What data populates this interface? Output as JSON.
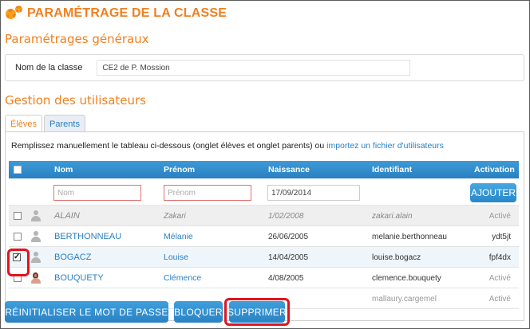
{
  "header": {
    "title": "PARAMÉTRAGE DE LA CLASSE",
    "icon": "gears-icon"
  },
  "general": {
    "title": "Paramétrages généraux",
    "class_name_label": "Nom de la classe",
    "class_name_value": "CE2 de P. Mossion"
  },
  "users": {
    "title": "Gestion des utilisateurs",
    "tabs": [
      {
        "label": "Élèves",
        "active": true
      },
      {
        "label": "Parents",
        "active": false
      }
    ],
    "instructions": "Remplissez manuellement le tableau ci-dessous (onglet élèves et onglet parents) ou",
    "import_link": "importez un fichier d'utilisateurs",
    "columns": {
      "nom": "Nom",
      "prenom": "Prénom",
      "naissance": "Naissance",
      "identifiant": "Identifiant",
      "activation": "Activation"
    },
    "add_row": {
      "nom_placeholder": "Nom",
      "prenom_placeholder": "Prénom",
      "date_value": "17/09/2014",
      "add_button": "AJOUTER"
    },
    "rows": [
      {
        "nom": "ALAIN",
        "prenom": "Zakari",
        "naissance": "1/02/2008",
        "identifiant": "zakari.alain",
        "activation": "Activé",
        "checked": false,
        "avatar": "person-icon"
      },
      {
        "nom": "BERTHONNEAU",
        "prenom": "Mélanie",
        "naissance": "26/06/2005",
        "identifiant": "melanie.berthonneau",
        "activation": "ydt5jt",
        "checked": false,
        "avatar": "person-icon"
      },
      {
        "nom": "BOGACZ",
        "prenom": "Louise",
        "naissance": "14/04/2005",
        "identifiant": "louise.bogacz",
        "activation": "fpf4dx",
        "checked": true,
        "avatar": "person-icon"
      },
      {
        "nom": "BOUQUETY",
        "prenom": "Clémence",
        "naissance": "4/08/2005",
        "identifiant": "clemence.bouquety",
        "activation": "Activé",
        "checked": false,
        "avatar": "girl-avatar-icon"
      },
      {
        "nom": "",
        "prenom": "",
        "naissance": "",
        "identifiant": "mallaury.cargemel",
        "activation": "Activé",
        "checked": false,
        "avatar": "person-icon"
      }
    ]
  },
  "bottom_actions": {
    "reset": "RÉINITIALISER LE MOT DE PASSE",
    "block": "BLOQUER",
    "delete": "SUPPRIMER"
  },
  "colors": {
    "accent_orange": "#f08020",
    "primary_blue": "#2a80c2",
    "highlight_red": "#e0141e"
  }
}
